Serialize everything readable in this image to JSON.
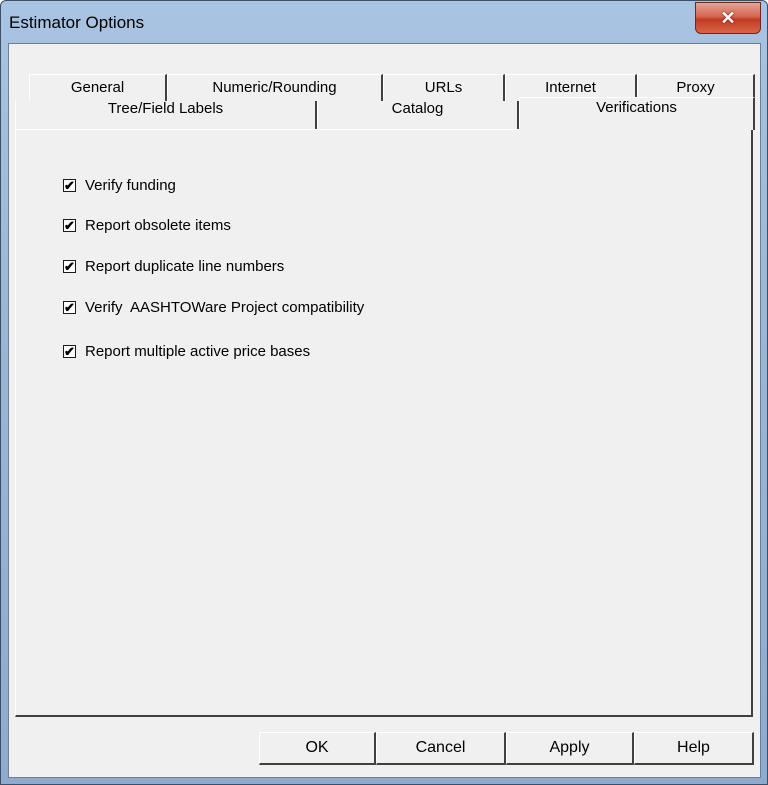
{
  "window": {
    "title": "Estimator Options",
    "close_glyph": "✕"
  },
  "tabs": {
    "back_row": [
      {
        "label": "General"
      },
      {
        "label": "Numeric/Rounding"
      },
      {
        "label": "URLs"
      },
      {
        "label": "Internet"
      },
      {
        "label": "Proxy"
      }
    ],
    "front_row": [
      {
        "label": "Tree/Field Labels"
      },
      {
        "label": "Catalog"
      },
      {
        "label": "Verifications",
        "active": true
      }
    ]
  },
  "verifications": {
    "options": [
      {
        "label": "Verify funding",
        "checked": true
      },
      {
        "label": "Report obsolete items",
        "checked": true
      },
      {
        "label": "Report duplicate line numbers",
        "checked": true
      },
      {
        "label": "Verify  AASHTOWare Project compatibility",
        "checked": true
      },
      {
        "label": "Report multiple active price bases",
        "checked": true
      }
    ]
  },
  "buttons": {
    "ok": "OK",
    "cancel": "Cancel",
    "apply": "Apply",
    "help": "Help"
  },
  "check_glyph": "✔"
}
